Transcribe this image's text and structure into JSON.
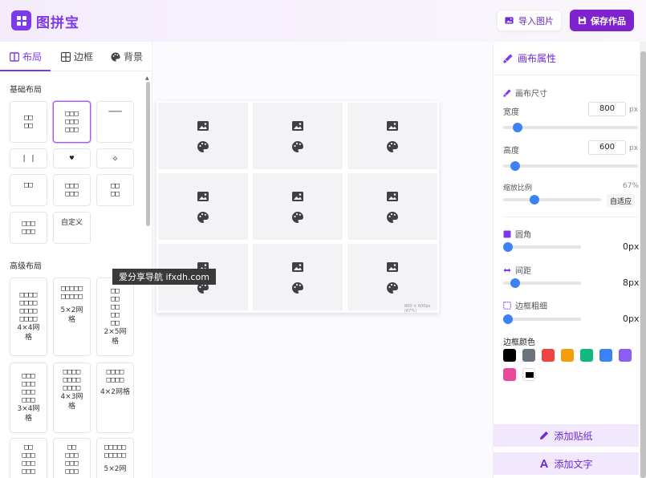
{
  "app": {
    "title": "图拼宝"
  },
  "header": {
    "import_label": "导入图片",
    "save_label": "保存作品"
  },
  "left": {
    "tabs": [
      {
        "label": "布局",
        "icon": "layout-icon"
      },
      {
        "label": "边框",
        "icon": "border-icon"
      },
      {
        "label": "背景",
        "icon": "palette-icon"
      }
    ],
    "basic_title": "基础布局",
    "advanced_title": "高级布局",
    "custom_label": "自定义",
    "advanced": [
      {
        "label": "4×4网格"
      },
      {
        "label": "5×2网格"
      },
      {
        "label": "2×5网格"
      },
      {
        "label": "3×4网格"
      },
      {
        "label": "4×3网格"
      },
      {
        "label": "4×2网格"
      },
      {
        "label": "5×2网"
      }
    ]
  },
  "canvas": {
    "info": "800 × 600px (67%)",
    "rows": 3,
    "cols": 3
  },
  "watermark": "爱分享导航 ifxdh.com",
  "right": {
    "title": "画布属性",
    "size_title": "画布尺寸",
    "width_label": "宽度",
    "width_value": "800",
    "height_label": "高度",
    "height_value": "600",
    "unit": "px",
    "scale_label": "缩放比例",
    "scale_value": "67%",
    "fit_label": "自适应",
    "radius_label": "圆角",
    "radius_value": "0px",
    "gap_label": "间距",
    "gap_value": "8px",
    "border_width_label": "边框粗细",
    "border_width_value": "0px",
    "border_color_label": "边框颜色",
    "colors": [
      "#000000",
      "#6b7280",
      "#ef4444",
      "#f59e0b",
      "#10b981",
      "#3b82f6",
      "#8b5cf6",
      "#ec4899",
      "#000000"
    ],
    "sticker_label": "添加贴纸",
    "text_label": "添加文字",
    "accent": "#7c3aed"
  }
}
